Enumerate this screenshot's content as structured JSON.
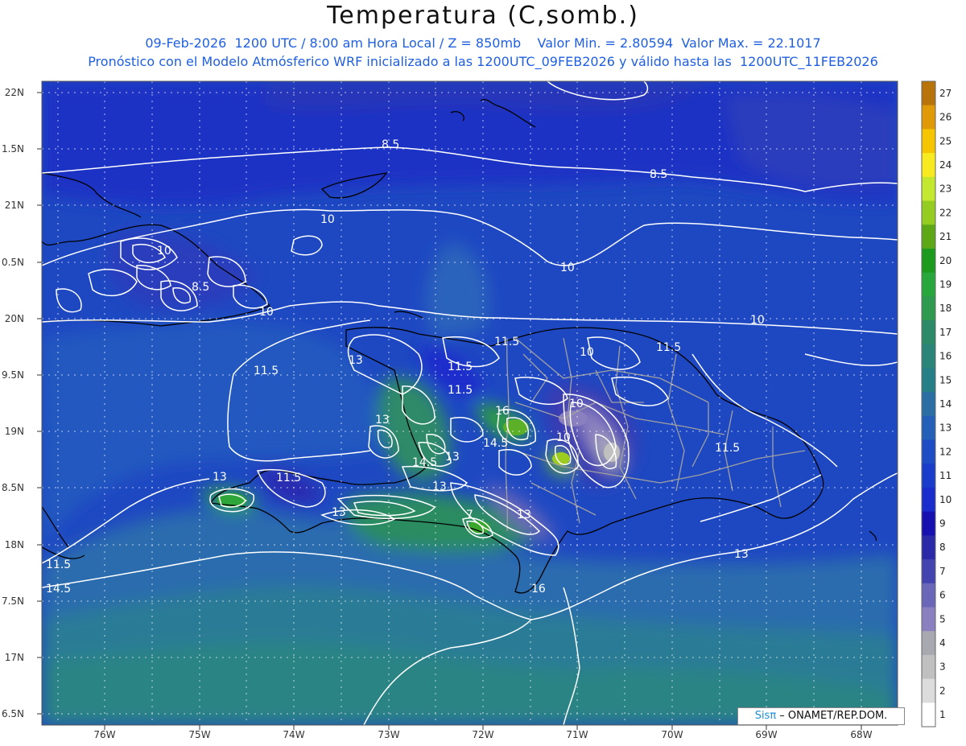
{
  "header": {
    "title": "Temperatura (C,somb.)",
    "subtitle_1": "09-Feb-2026  1200 UTC / 8:00 am Hora Local / Z = 850mb    Valor Min. = 2.80594  Valor Max. = 22.1017",
    "subtitle_2": "Pronóstico con el Modelo Atmósferico WRF inicializado a las 1200UTC_09FEB2026 y válido hasta las  1200UTC_11FEB2026"
  },
  "axes": {
    "lat_labels": [
      "22N",
      "1.5N",
      "21N",
      "0.5N",
      "20N",
      "9.5N",
      "19N",
      "8.5N",
      "18N",
      "7.5N",
      "17N",
      "6.5N"
    ],
    "lon_labels": [
      "76W",
      "75W",
      "74W",
      "73W",
      "72W",
      "71W",
      "70W",
      "69W",
      "68W"
    ],
    "grid": "dotted"
  },
  "contours": [
    {
      "label": "8.5"
    },
    {
      "label": "8.5"
    },
    {
      "label": "8.5"
    },
    {
      "label": "10"
    },
    {
      "label": "10"
    },
    {
      "label": "10"
    },
    {
      "label": "10"
    },
    {
      "label": "10"
    },
    {
      "label": "10"
    },
    {
      "label": "11.5"
    },
    {
      "label": "11.5"
    },
    {
      "label": "11.5"
    },
    {
      "label": "11.5"
    },
    {
      "label": "11.5"
    },
    {
      "label": "11.5"
    },
    {
      "label": "11.5"
    },
    {
      "label": "11.5"
    },
    {
      "label": "13"
    },
    {
      "label": "13"
    },
    {
      "label": "13"
    },
    {
      "label": "13"
    },
    {
      "label": "13"
    },
    {
      "label": "13"
    },
    {
      "label": "13"
    },
    {
      "label": "13"
    },
    {
      "label": "14.5"
    },
    {
      "label": "14.5"
    },
    {
      "label": "14.5"
    },
    {
      "label": "16"
    },
    {
      "label": "16"
    },
    {
      "label": "7"
    },
    {
      "label": "10"
    },
    {
      "label": "10"
    }
  ],
  "colorbar": {
    "labels": [
      "27",
      "26",
      "25",
      "24",
      "23",
      "22",
      "21",
      "20",
      "19",
      "18",
      "17",
      "16",
      "15",
      "14",
      "13",
      "12",
      "11",
      "10",
      "9",
      "8",
      "7",
      "6",
      "5",
      "4",
      "3",
      "2",
      "1"
    ],
    "colors": [
      "#b8740a",
      "#e09a08",
      "#f5c500",
      "#f8ea20",
      "#c4e830",
      "#94cc22",
      "#5ea818",
      "#1c9a1e",
      "#28a83c",
      "#2e9a50",
      "#2d8a68",
      "#2a8478",
      "#267e86",
      "#2a6ea4",
      "#2460b8",
      "#1e4cc4",
      "#1a3cca",
      "#1a2ccc",
      "#1610b0",
      "#2a2aa8",
      "#4444b0",
      "#6a66b8",
      "#8a80c0",
      "#a8a8b0",
      "#c0c0c0",
      "#dcdcdc",
      "#ffffff"
    ]
  },
  "credit": {
    "brand": "Sisπ",
    "text": " – ONAMET/REP.DOM."
  }
}
